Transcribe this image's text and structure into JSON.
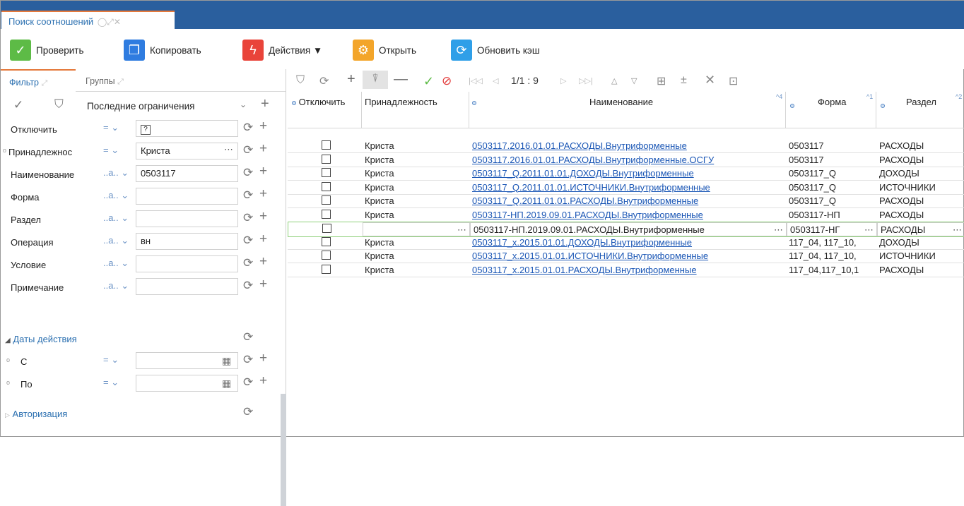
{
  "window_tab": {
    "title": "Поиск соотношений",
    "icons": "◯⤢✕"
  },
  "toolbar": {
    "check": "Проверить",
    "copy": "Копировать",
    "actions": "Действия ▼",
    "open": "Открыть",
    "refresh_cache": "Обновить кэш"
  },
  "left_panel": {
    "tab_filter": "Фильтр",
    "tab_groups": "Группы",
    "last_limits": "Последние ограничения",
    "fields": [
      {
        "label": "Отключить",
        "op": "= ⌄",
        "value": "?"
      },
      {
        "label": "Принадлежнос",
        "op": "= ⌄",
        "value": "Криста"
      },
      {
        "label": "Наименование",
        "op": "..a.. ⌄",
        "value": "0503117"
      },
      {
        "label": "Форма",
        "op": "..a.. ⌄",
        "value": ""
      },
      {
        "label": "Раздел",
        "op": "..a.. ⌄",
        "value": ""
      },
      {
        "label": "Операция",
        "op": "..a.. ⌄",
        "value": "вн"
      },
      {
        "label": "Условие",
        "op": "..a.. ⌄",
        "value": ""
      },
      {
        "label": "Примечание",
        "op": "..a.. ⌄",
        "value": ""
      }
    ],
    "group_dates": "Даты действия",
    "date_from": "С",
    "date_to": "По",
    "group_auth": "Авторизация",
    "date_op": "= ⌄"
  },
  "grid_toolbar": {
    "pager": "1/1 : 9"
  },
  "grid": {
    "columns": [
      "Отключить",
      "Принадлежность",
      "Наименование",
      "Форма",
      "Раздел"
    ],
    "sort_badges": {
      "name": "^4",
      "form": "^1",
      "section": "^2"
    },
    "rows": [
      {
        "owner": "Криста",
        "name": "0503117.2016.01.01.РАСХОДЫ.Внутриформенные",
        "form": "0503117",
        "section": "РАСХОДЫ"
      },
      {
        "owner": "Криста",
        "name": "0503117.2016.01.01.РАСХОДЫ.Внутриформенные.ОСГУ",
        "form": "0503117",
        "section": "РАСХОДЫ"
      },
      {
        "owner": "Криста",
        "name": "0503117_Q.2011.01.01.ДОХОДЫ.Внутриформенные",
        "form": "0503117_Q",
        "section": "ДОХОДЫ"
      },
      {
        "owner": "Криста",
        "name": "0503117_Q.2011.01.01.ИСТОЧНИКИ.Внутриформенные",
        "form": "0503117_Q",
        "section": "ИСТОЧНИКИ"
      },
      {
        "owner": "Криста",
        "name": "0503117_Q.2011.01.01.РАСХОДЫ.Внутриформенные",
        "form": "0503117_Q",
        "section": "РАСХОДЫ"
      },
      {
        "owner": "Криста",
        "name": "0503117-НП.2019.09.01.РАСХОДЫ.Внутриформенные",
        "form": "0503117-НП",
        "section": "РАСХОДЫ"
      },
      {
        "owner": "",
        "name": "0503117-НП.2019.09.01.РАСХОДЫ.Внутриформенные",
        "form": "0503117-НГ",
        "section": "РАСХОДЫ"
      },
      {
        "owner": "Криста",
        "name": "0503117_x.2015.01.01.ДОХОДЫ.Внутриформенные",
        "form": "117_04, 117_10,",
        "section": "ДОХОДЫ"
      },
      {
        "owner": "Криста",
        "name": "0503117_x.2015.01.01.ИСТОЧНИКИ.Внутриформенные",
        "form": "117_04, 117_10,",
        "section": "ИСТОЧНИКИ"
      },
      {
        "owner": "Криста",
        "name": "0503117_x.2015.01.01.РАСХОДЫ.Внутриформенные",
        "form": "117_04,117_10,1",
        "section": "РАСХОДЫ"
      }
    ]
  }
}
